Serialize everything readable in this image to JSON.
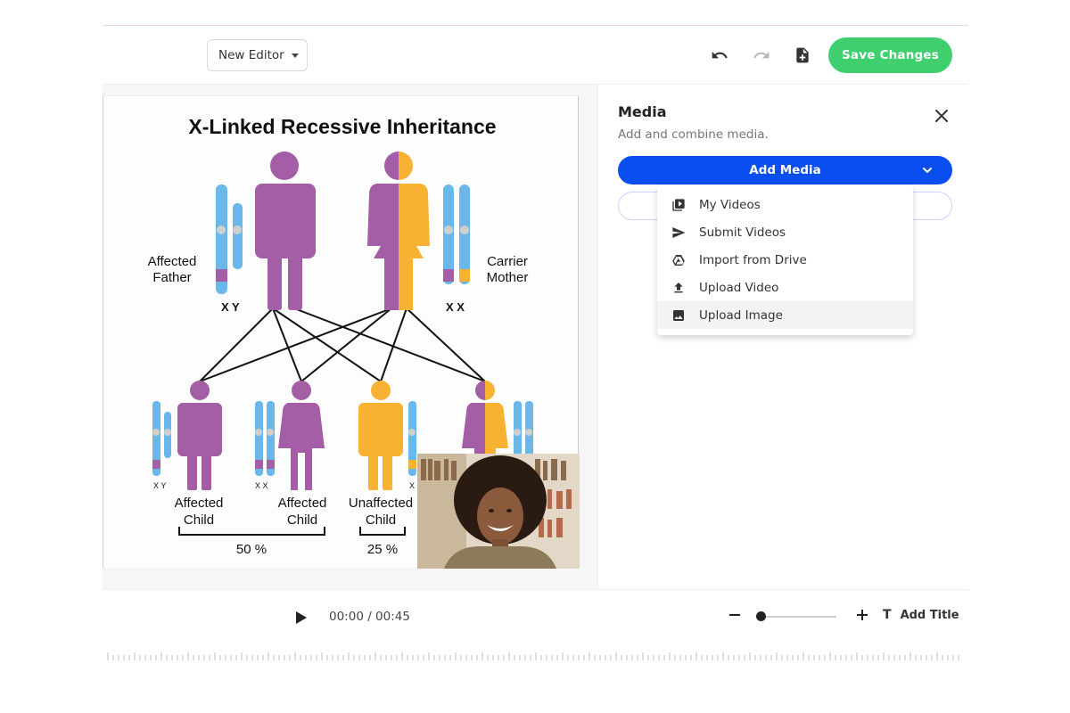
{
  "header": {
    "editor_select": "New Editor",
    "save_label": "Save Changes"
  },
  "slide": {
    "title": "X-Linked Recessive Inheritance",
    "parents": [
      {
        "label_line1": "Affected",
        "label_line2": "Father",
        "chromosomes": "X  Y"
      },
      {
        "label_line1": "Carrier",
        "label_line2": "Mother",
        "chromosomes": "X  X"
      }
    ],
    "children": [
      {
        "label_line1": "Affected",
        "label_line2": "Child",
        "chromosomes": "X Y"
      },
      {
        "label_line1": "Affected",
        "label_line2": "Child",
        "chromosomes": "X X"
      },
      {
        "label_line1": "Unaffected",
        "label_line2": "Child",
        "chromosomes": "X"
      }
    ],
    "percent_left": "50 %",
    "percent_right": "25 %"
  },
  "panel": {
    "title": "Media",
    "subtitle": "Add and combine media.",
    "add_media_label": "Add Media",
    "menu": [
      {
        "label": "My Videos",
        "icon": "video-library-icon"
      },
      {
        "label": "Submit Videos",
        "icon": "send-icon"
      },
      {
        "label": "Import from Drive",
        "icon": "drive-icon"
      },
      {
        "label": "Upload Video",
        "icon": "upload-icon"
      },
      {
        "label": "Upload Image",
        "icon": "image-icon"
      }
    ]
  },
  "player": {
    "time": "00:00 / 00:45",
    "add_title_label": "Add Title"
  },
  "colors": {
    "accent_green": "#3fcf6e",
    "accent_blue": "#0a4ef0",
    "purple": "#a45ea6",
    "orange": "#f7b133",
    "chromosome_blue": "#6ab8ea"
  }
}
